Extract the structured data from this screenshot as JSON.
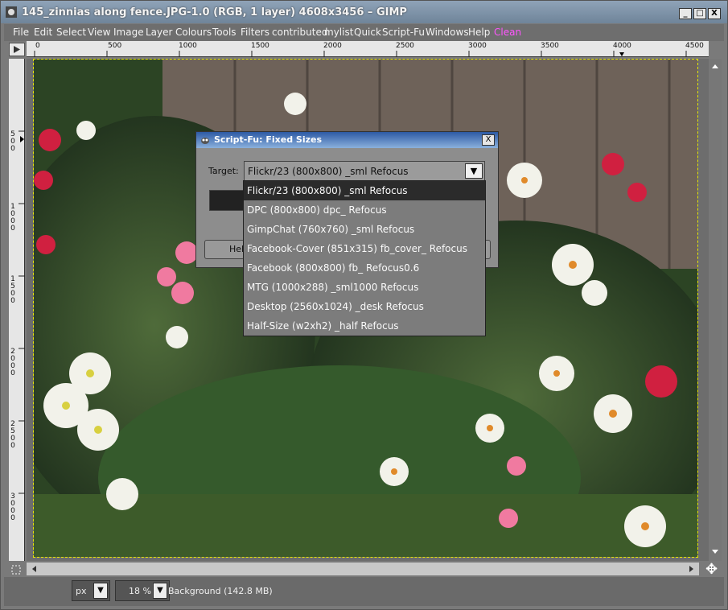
{
  "window": {
    "title": "145_zinnias along fence.JPG-1.0 (RGB, 1 layer) 4608x3456 – GIMP",
    "min_label": "_",
    "max_label": "□",
    "close_label": "X"
  },
  "menu": {
    "items": [
      "File",
      "Edit",
      "Select",
      "View",
      "Image",
      "Layer",
      "Colours",
      "Tools",
      "Filters",
      "contributed",
      "mylist",
      "Quick",
      "Script-Fu",
      "Windows",
      "Help",
      "Clean"
    ]
  },
  "ruler_top": {
    "labels": [
      "0",
      "500",
      "1000",
      "1500",
      "2000",
      "2500",
      "3000",
      "3500",
      "4000",
      "4500"
    ]
  },
  "ruler_left": {
    "labels": [
      "500",
      "1000",
      "1500",
      "2000",
      "2500",
      "3000"
    ]
  },
  "dialog": {
    "title": "Script-Fu: Fixed Sizes",
    "close_label": "X",
    "target_label": "Target:",
    "selected": "Flickr/23 (800x800) _sml Refocus",
    "help_label": "Help",
    "options": [
      "Flickr/23 (800x800) _sml Refocus",
      "DPC (800x800) dpc_ Refocus",
      "GimpChat (760x760) _sml Refocus",
      "Facebook-Cover (851x315) fb_cover_ Refocus",
      "Facebook (800x800) fb_ Refocus0.6",
      "MTG (1000x288) _sml1000 Refocus",
      "Desktop (2560x1024) _desk Refocus",
      "Half-Size (w2xh2) _half Refocus"
    ]
  },
  "status": {
    "unit": "px",
    "zoom": "18 %",
    "message": "Background (142.8 MB)"
  },
  "colors": {
    "dialog_title": "#2d5aa5",
    "selection_border": "#e6e600",
    "clean_menu": "#ff55ff"
  }
}
